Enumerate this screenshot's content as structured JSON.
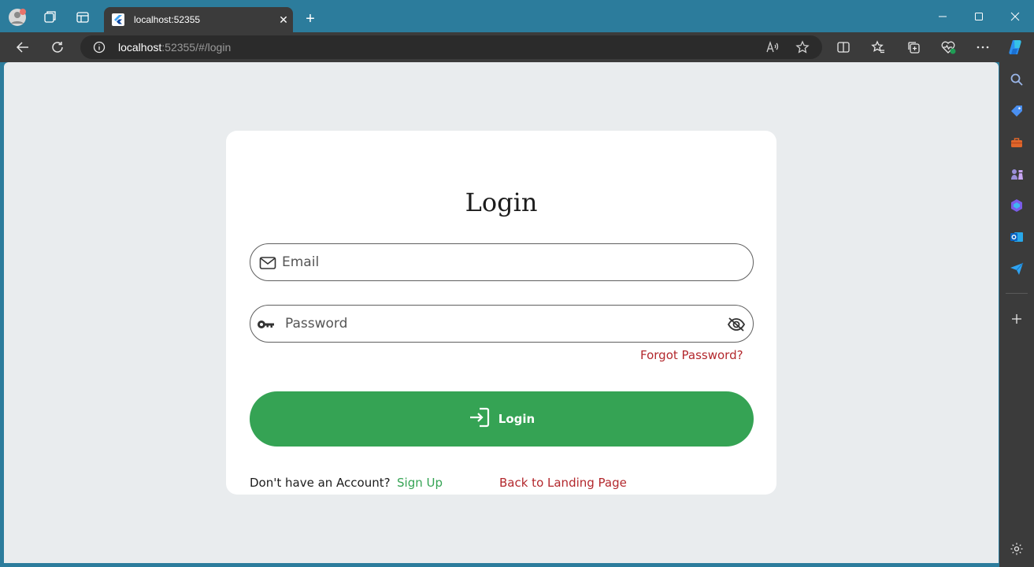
{
  "browser": {
    "tab_title": "localhost:52355",
    "url_host": "localhost",
    "url_rest": ":52355/#/login",
    "accent": "#2c7c9c"
  },
  "login": {
    "title": "Login",
    "email_placeholder": "Email",
    "password_placeholder": "Password",
    "forgot_label": "Forgot Password?",
    "button_label": "Login",
    "no_account_text": "Don't have an Account?",
    "signup_label": "Sign Up",
    "back_label": "Back to Landing Page"
  },
  "colors": {
    "primary_green": "#35a354",
    "link_red": "#b3282d",
    "page_bg": "#e9ecee"
  }
}
